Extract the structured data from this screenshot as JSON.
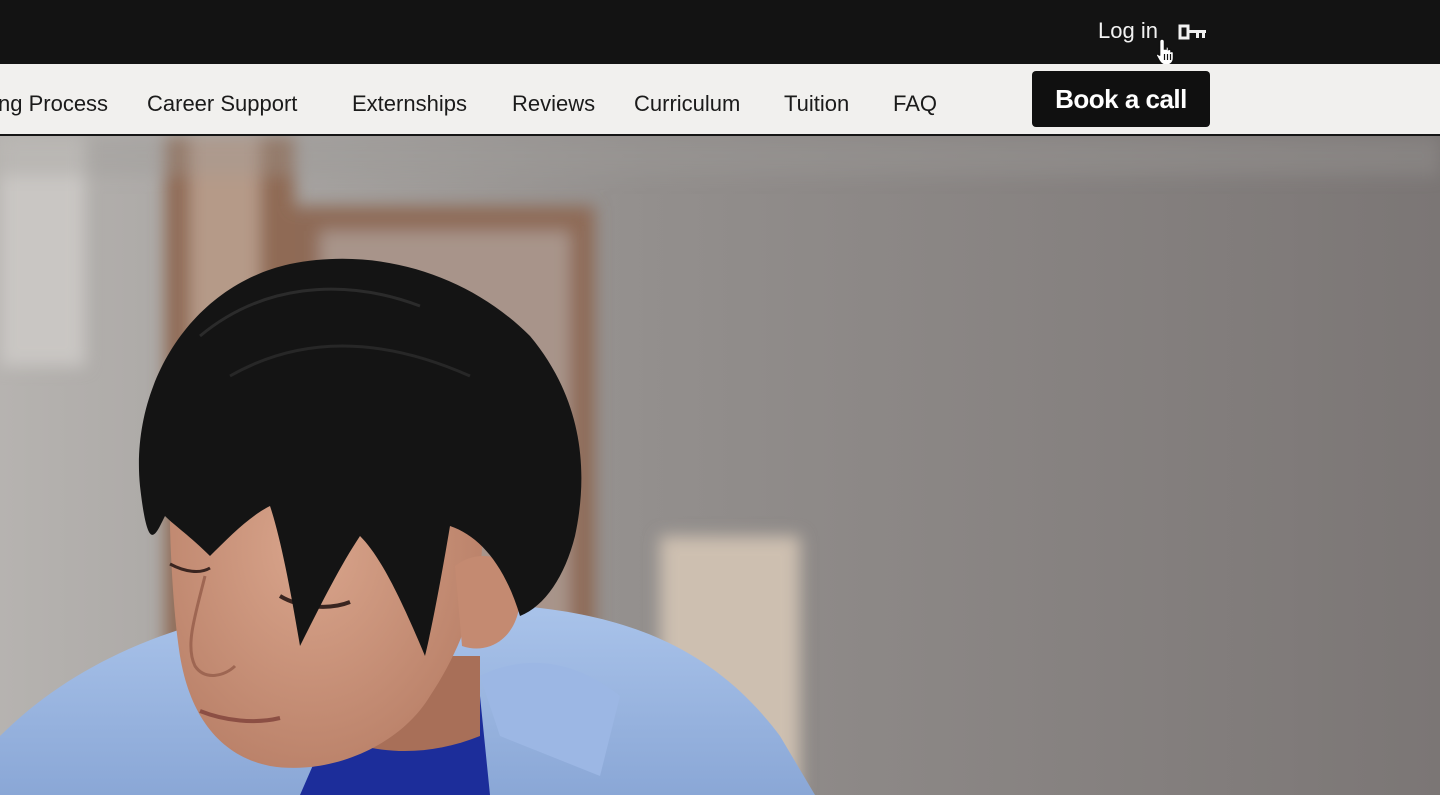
{
  "topbar": {
    "login_label": "Log in",
    "icon": "key-icon",
    "cursor": "hand-pointer-icon"
  },
  "nav": {
    "items": [
      {
        "label": "ng Process"
      },
      {
        "label": "Career Support"
      },
      {
        "label": "Externships"
      },
      {
        "label": "Reviews"
      },
      {
        "label": "Curriculum"
      },
      {
        "label": "Tuition"
      },
      {
        "label": "FAQ"
      }
    ],
    "cta_label": "Book a call"
  },
  "hero": {
    "image": "photo-young-man-looking-down"
  },
  "colors": {
    "topbar_bg": "#131313",
    "navbar_bg": "#f1f0ee",
    "button_bg": "#101010",
    "shirt": "#9fbbe3"
  }
}
